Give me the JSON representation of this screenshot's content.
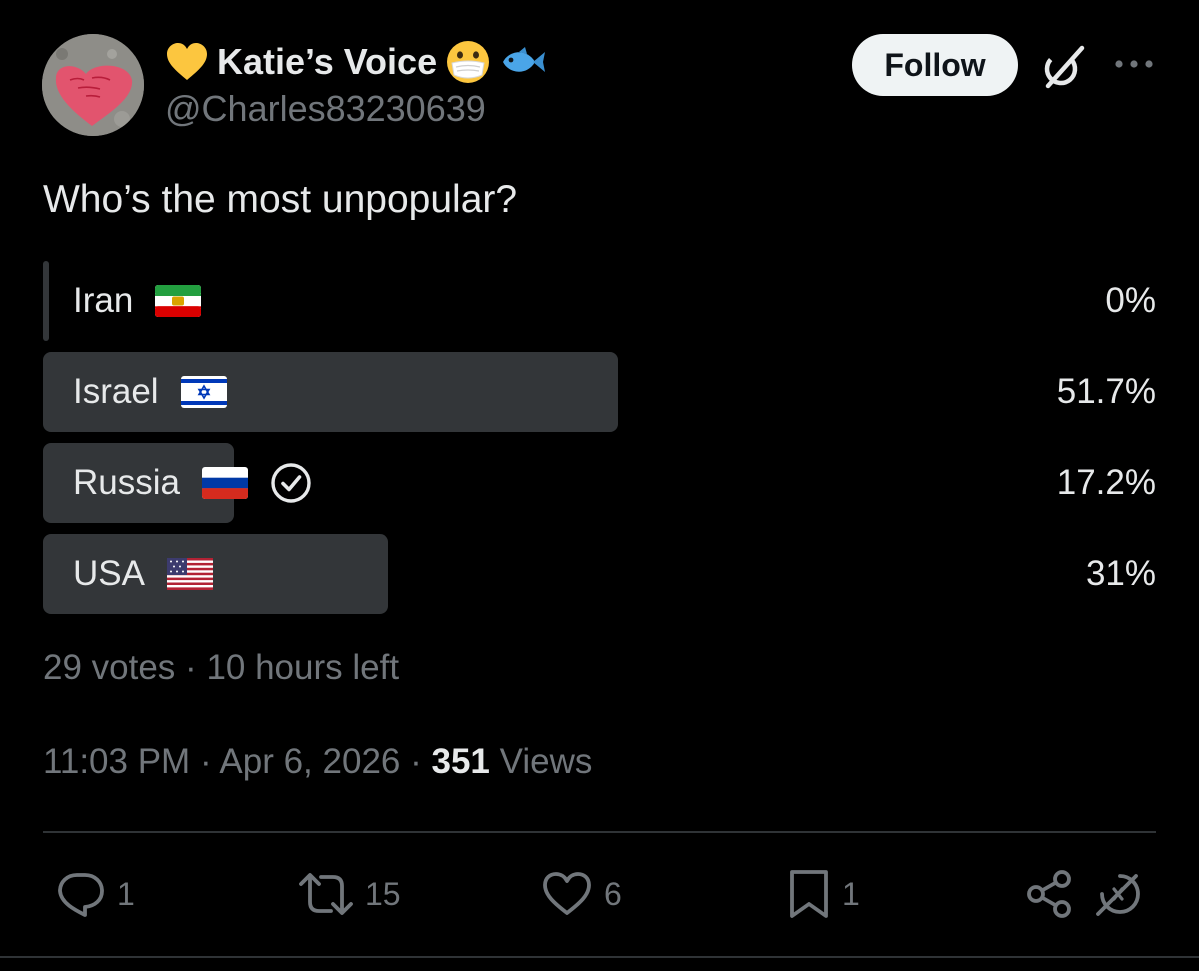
{
  "author": {
    "display_name": "Katie’s Voice",
    "handle": "@Charles83230639",
    "badges": [
      "yellow-heart-icon",
      "face-with-medical-mask-icon",
      "fish-icon"
    ]
  },
  "header": {
    "follow_label": "Follow"
  },
  "tweet": {
    "text": "Who’s the most unpopular?"
  },
  "poll": {
    "options": [
      {
        "label": "Iran",
        "flag": "iran-flag-icon",
        "percent_label": "0%",
        "percent": 0,
        "voted": false
      },
      {
        "label": "Israel",
        "flag": "israel-flag-icon",
        "percent_label": "51.7%",
        "percent": 51.7,
        "voted": false
      },
      {
        "label": "Russia",
        "flag": "russia-flag-icon",
        "percent_label": "17.2%",
        "percent": 17.2,
        "voted": true
      },
      {
        "label": "USA",
        "flag": "usa-flag-icon",
        "percent_label": "31%",
        "percent": 31,
        "voted": false
      }
    ],
    "votes": "29 votes",
    "separator": "·",
    "time_left": "10 hours left"
  },
  "meta": {
    "time": "11:03 PM",
    "date": "Apr 6, 2026",
    "views_count": "351",
    "views_label": "Views"
  },
  "actions": {
    "replies": "1",
    "reposts": "15",
    "likes": "6",
    "bookmarks": "1"
  },
  "colors": {
    "background": "#000000",
    "text": "#e7e9ea",
    "muted": "#71767b",
    "poll_bar": "#333639",
    "divider": "#2f3336"
  }
}
